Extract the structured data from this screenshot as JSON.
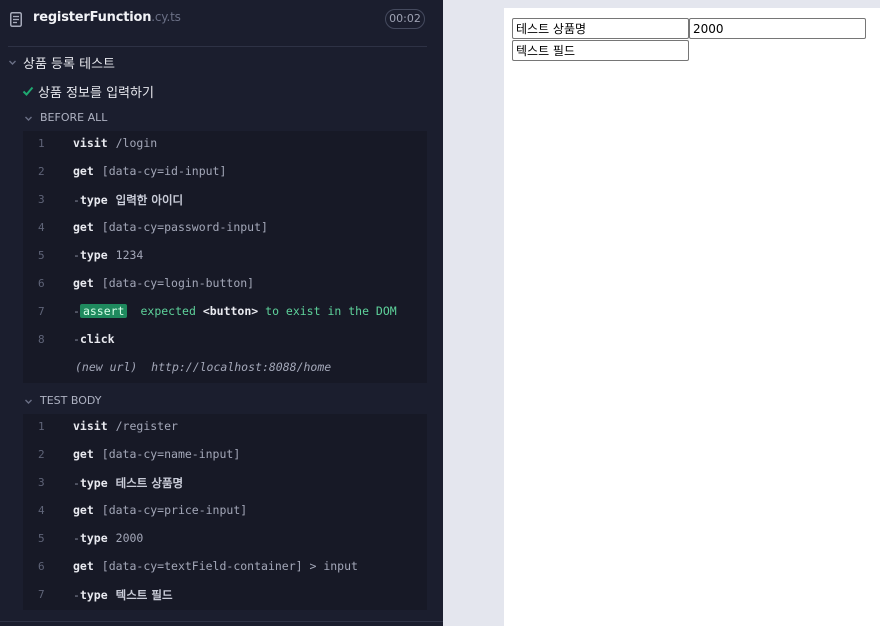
{
  "spec": {
    "name": "registerFunction",
    "ext": ".cy.ts",
    "timer": "00:02"
  },
  "suite": {
    "title": "상품 등록 테스트"
  },
  "test": {
    "title": "상품 정보를 입력하기"
  },
  "before_all": {
    "title": "BEFORE ALL",
    "commands": [
      {
        "num": "1",
        "prefix": "",
        "name": "visit",
        "message": "/login"
      },
      {
        "num": "2",
        "prefix": "",
        "name": "get",
        "message": "[data-cy=id-input]"
      },
      {
        "num": "3",
        "prefix": "-",
        "name": "type",
        "message": "입력한 아이디"
      },
      {
        "num": "4",
        "prefix": "",
        "name": "get",
        "message": "[data-cy=password-input]"
      },
      {
        "num": "5",
        "prefix": "-",
        "name": "type",
        "message": "1234"
      },
      {
        "num": "6",
        "prefix": "",
        "name": "get",
        "message": "[data-cy=login-button]"
      },
      {
        "num": "7",
        "prefix": "-",
        "name": "assert",
        "message": "expected",
        "subject": "<button>",
        "tail": "to exist in the DOM"
      },
      {
        "num": "8",
        "prefix": "-",
        "name": "click",
        "message": ""
      },
      {
        "label": "(new url)",
        "url": "http://localhost:8088/home"
      }
    ]
  },
  "test_body": {
    "title": "TEST BODY",
    "commands": [
      {
        "num": "1",
        "prefix": "",
        "name": "visit",
        "message": "/register"
      },
      {
        "num": "2",
        "prefix": "",
        "name": "get",
        "message": "[data-cy=name-input]"
      },
      {
        "num": "3",
        "prefix": "-",
        "name": "type",
        "message": "테스트 상품명"
      },
      {
        "num": "4",
        "prefix": "",
        "name": "get",
        "message": "[data-cy=price-input]"
      },
      {
        "num": "5",
        "prefix": "-",
        "name": "type",
        "message": "2000"
      },
      {
        "num": "6",
        "prefix": "",
        "name": "get",
        "message": "[data-cy=textField-container] > input"
      },
      {
        "num": "7",
        "prefix": "-",
        "name": "type",
        "message": "텍스트 필드"
      }
    ]
  },
  "aut": {
    "name_value": "테스트 상품명",
    "price_value": "2000",
    "text_value": "텍스트 필드"
  },
  "colors": {
    "panel_bg": "#1b1e2e",
    "command_bg": "#171926",
    "pass": "#1fa971",
    "assert_badge": "#1f8a5e"
  },
  "icons": {
    "file": "file-text-icon",
    "collapse": "chevron-down-icon",
    "pass": "checkmark-icon"
  }
}
